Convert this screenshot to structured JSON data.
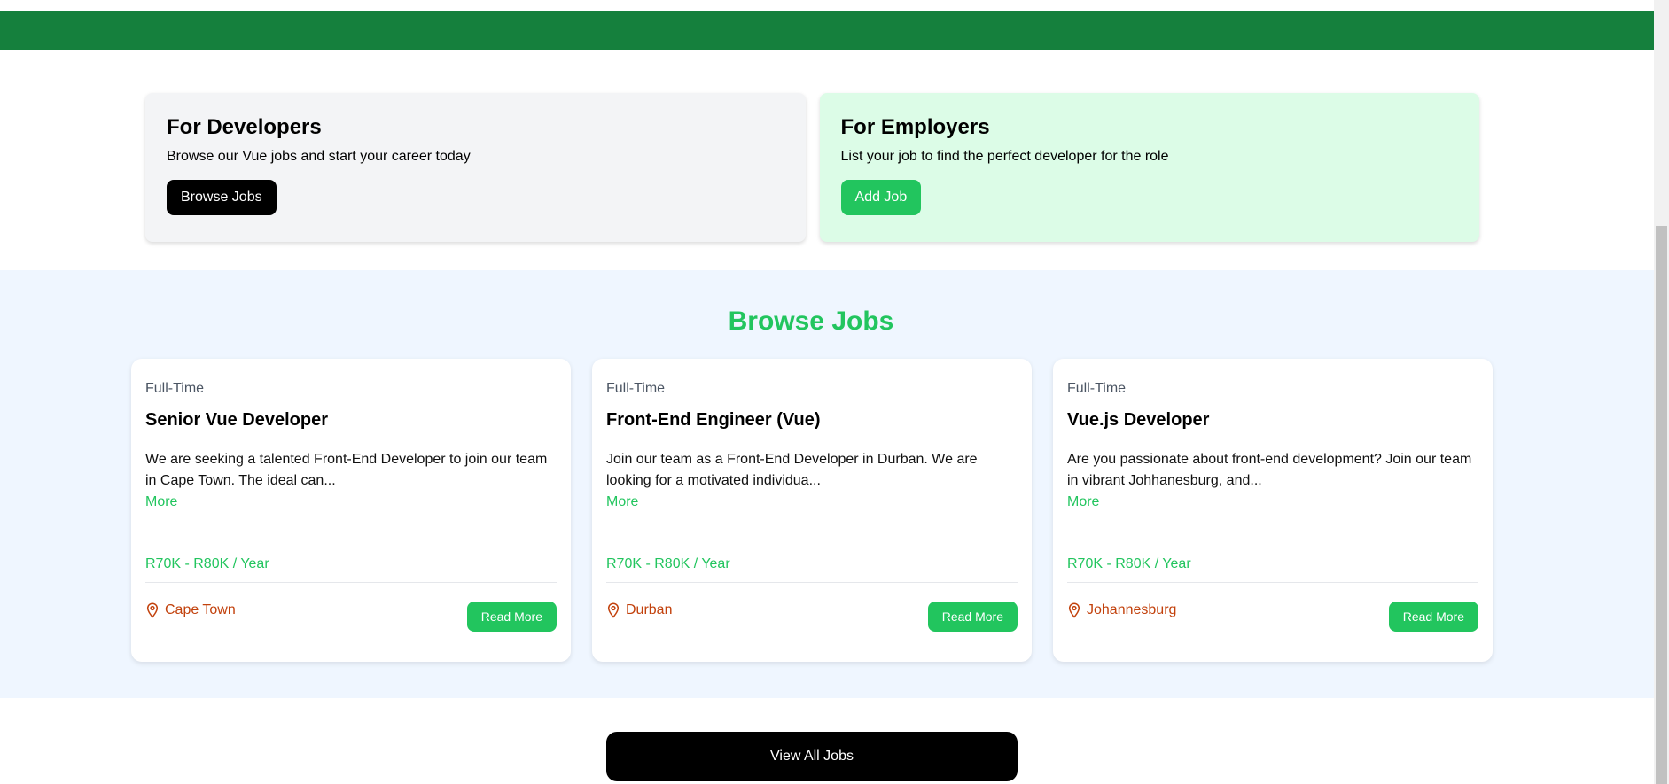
{
  "developers_card": {
    "title": "For Developers",
    "description": "Browse our Vue jobs and start your career today",
    "button_label": "Browse Jobs"
  },
  "employers_card": {
    "title": "For Employers",
    "description": "List your job to find the perfect developer for the role",
    "button_label": "Add Job"
  },
  "jobs_section": {
    "title": "Browse Jobs",
    "jobs": [
      {
        "type": "Full-Time",
        "title": "Senior Vue Developer",
        "description_line1": "We are seeking a talented Front-End Developer to join our team",
        "description_line2": "in Cape Town. The ideal can...",
        "more_label": "More",
        "salary": "R70K - R80K / Year",
        "location": "Cape Town",
        "button_label": "Read More"
      },
      {
        "type": "Full-Time",
        "title": "Front-End Engineer (Vue)",
        "description_line1": "Join our team as a Front-End Developer in Durban. We are",
        "description_line2": "looking for a motivated individua...",
        "more_label": "More",
        "salary": "R70K - R80K / Year",
        "location": "Durban",
        "button_label": "Read More"
      },
      {
        "type": "Full-Time",
        "title": "Vue.js Developer",
        "description_line1": "Are you passionate about front-end development? Join our team",
        "description_line2": "in vibrant Johhanesburg, and...",
        "more_label": "More",
        "salary": "R70K - R80K / Year",
        "location": "Johannesburg",
        "button_label": "Read More"
      }
    ]
  },
  "view_all_label": "View All Jobs",
  "colors": {
    "navbar": "#15803d",
    "accent_green": "#22c55e",
    "location_orange": "#c2410c",
    "section_bg": "#eff6ff"
  },
  "icons": {
    "location": "map-marker-icon"
  }
}
